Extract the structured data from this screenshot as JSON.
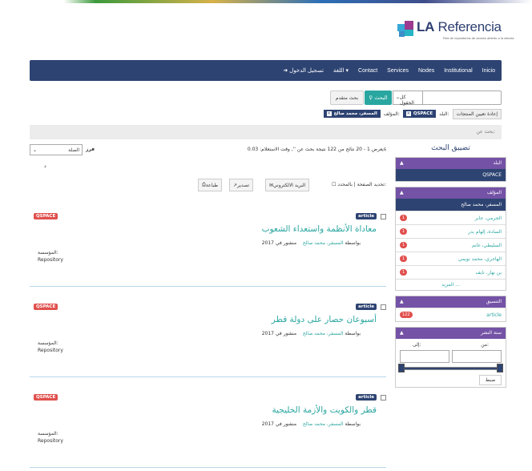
{
  "logo": {
    "name_bold": "LA",
    "name_rest": " Referencia",
    "tagline": "Red de repositorios de acceso abierto a la ciencia"
  },
  "nav": {
    "items": [
      "Inicio",
      "Institutional",
      "Nodes",
      "Services",
      "Contact",
      "اللغة",
      "تسجيل الدخول"
    ]
  },
  "search": {
    "field_select": "كل الحقول",
    "search_button": "البحث",
    "advanced_button": "بحث متقدم",
    "input_value": ""
  },
  "filters": {
    "reset": "إعادة تعيين المنتجات",
    "country_label": "البلد:",
    "country_value": "QSPACE",
    "author_label": "المؤلف:",
    "author_value": "المسفر، محمد صالح"
  },
  "search_for": "بحث عن:",
  "sidebar": {
    "title": "تضييق البحث",
    "country": {
      "header": "البلد",
      "selected": "QSPACE"
    },
    "author": {
      "header": "المؤلف",
      "selected": "المسفر، محمد صالح",
      "items": [
        {
          "label": "الجرمي، جابر",
          "count": "1"
        },
        {
          "label": "السادة، إلهام بدر",
          "count": "1"
        },
        {
          "label": "السليطي، غانم",
          "count": "1"
        },
        {
          "label": "الهاجري، محمد نويمي",
          "count": "1"
        },
        {
          "label": "بن نهار، نايف",
          "count": "1"
        }
      ],
      "more": "المزيد ..."
    },
    "format": {
      "header": "التنسيق",
      "items": [
        {
          "label": "article",
          "count": "122"
        }
      ]
    },
    "year": {
      "header": "سنة النشر",
      "from_label": "من:",
      "to_label": "إلى:",
      "apply": "ضبط"
    }
  },
  "results": {
    "sort_label": "فرز",
    "sort_value": "الصلة",
    "info": "يعرض 1 - 20 نتائج من 122 نتيجة بحث عن '', وقت الاستعلام: 0.03s",
    "dot": "د",
    "select_label": "تحديد الصفحة | بالمحدد:",
    "email_btn": "البريد الالكتروني",
    "export_btn": "تصدير",
    "print_btn": "طباعة",
    "items": [
      {
        "source": "QSPACE",
        "type": "article",
        "title": "معاداة الأنظمة واستعداء الشعوب",
        "by": "بواسطة",
        "author": "المسفر، محمد صالح",
        "published": "منشور في 2017",
        "inst_label": "المؤسسة:",
        "inst": "Repository"
      },
      {
        "source": "QSPACE",
        "type": "article",
        "title": "أسبوعان حصار على دولة قطر",
        "by": "بواسطة",
        "author": "المسفر، محمد صالح",
        "published": "منشور في 2017",
        "inst_label": "المؤسسة:",
        "inst": "Repository"
      },
      {
        "source": "QSPACE",
        "type": "article",
        "title": "قطر والكويت والأزمة الخليجية",
        "by": "بواسطة",
        "author": "المسفر، محمد صالح",
        "published": "منشور في 2017",
        "inst_label": "المؤسسة:",
        "inst": "Repository"
      }
    ]
  },
  "colors": {
    "navy": "#2d4372",
    "teal": "#2aa6a0",
    "red": "#e0504d",
    "purple": "#7452a6"
  }
}
